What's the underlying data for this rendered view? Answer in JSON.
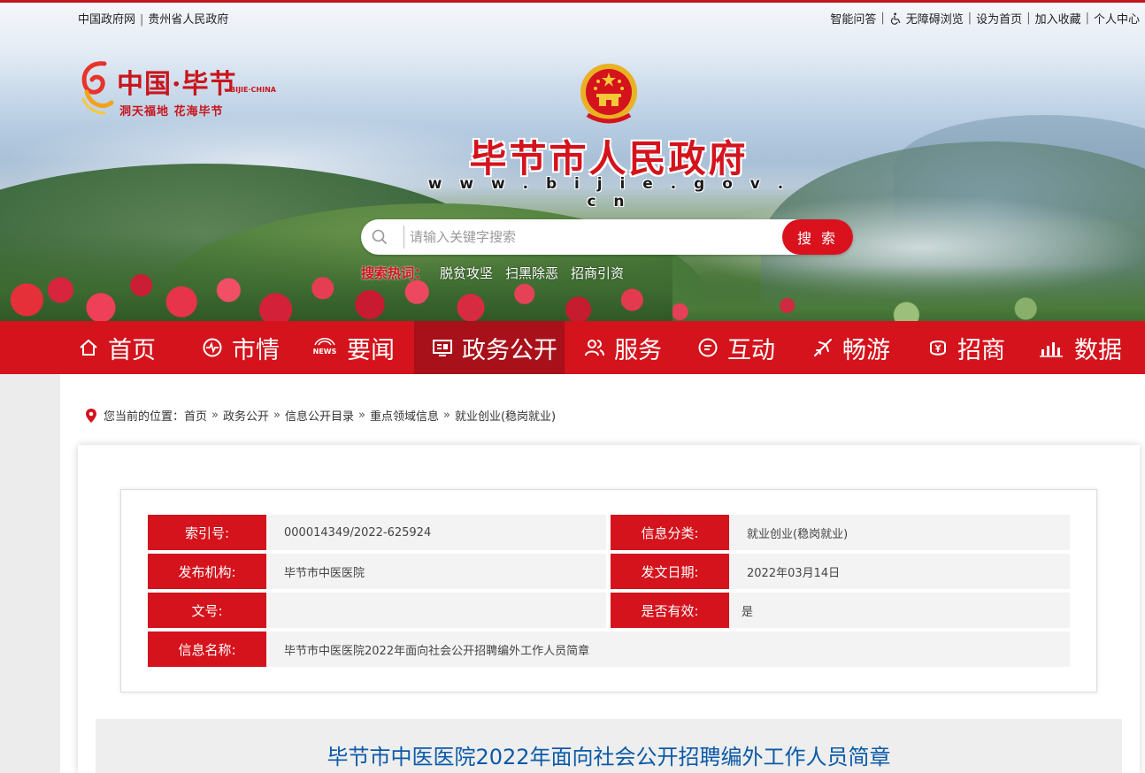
{
  "top_left_links": [
    "中国政府网",
    "贵州省人民政府"
  ],
  "top_right_links": [
    "智能问答",
    "无障碍浏览",
    "设为首页",
    "加入收藏",
    "个人中心"
  ],
  "logo": {
    "title": "中国·毕节",
    "english": "BIJIE·CHINA",
    "slogan": "洞天福地  花海毕节"
  },
  "site": {
    "title": "毕节市人民政府",
    "url": "w w w . b i j i e . g o v . c n"
  },
  "search": {
    "placeholder": "请输入关键字搜索",
    "button": "搜 索"
  },
  "hot": {
    "label": "搜索热词：",
    "words": [
      "脱贫攻坚",
      "扫黑除恶",
      "招商引资"
    ]
  },
  "nav": [
    {
      "label": "首页",
      "icon": "home-icon"
    },
    {
      "label": "市情",
      "icon": "pulse-icon"
    },
    {
      "label": "要闻",
      "icon": "news-icon"
    },
    {
      "label": "政务公开",
      "icon": "board-icon",
      "active": true
    },
    {
      "label": "服务",
      "icon": "people-icon"
    },
    {
      "label": "互动",
      "icon": "chat-icon"
    },
    {
      "label": "畅游",
      "icon": "plane-icon"
    },
    {
      "label": "招商",
      "icon": "yen-icon"
    },
    {
      "label": "数据",
      "icon": "bars-icon"
    }
  ],
  "breadcrumb": {
    "prefix": "您当前的位置：",
    "items": [
      "首页",
      "政务公开",
      "信息公开目录",
      "重点领域信息",
      "就业创业(稳岗就业)"
    ]
  },
  "meta": {
    "index_label": "索引号:",
    "index_value": "000014349/2022-625924",
    "category_label": "信息分类:",
    "category_value": "就业创业(稳岗就业)",
    "publisher_label": "发布机构:",
    "publisher_value": "毕节市中医医院",
    "date_label": "发文日期:",
    "date_value": "2022年03月14日",
    "docno_label": "文号:",
    "docno_value": "",
    "valid_label": "是否有效:",
    "valid_value": "是",
    "name_label": "信息名称:",
    "name_value": "毕节市中医医院2022年面向社会公开招聘编外工作人员简章"
  },
  "article": {
    "title": "毕节市中医医院2022年面向社会公开招聘编外工作人员简章"
  },
  "colors": {
    "brand_red": "#d4131c",
    "title_blue": "#0b5aa8"
  }
}
